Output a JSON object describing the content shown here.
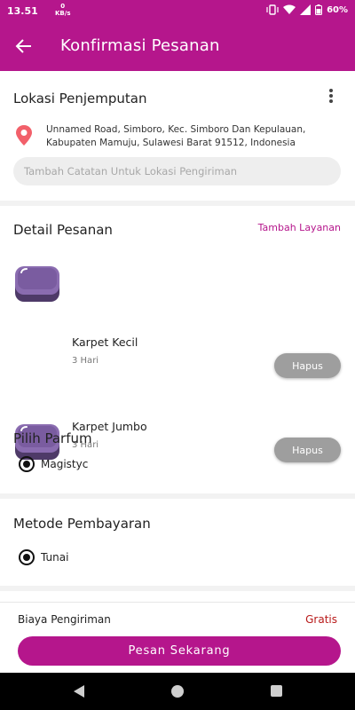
{
  "status_bar": {
    "time": "13.51",
    "netspeed_value": "0",
    "netspeed_unit": "KB/s",
    "battery": "60%"
  },
  "header": {
    "title": "Konfirmasi Pesanan"
  },
  "pickup": {
    "title": "Lokasi Penjemputan",
    "address": "Unnamed Road, Simboro, Kec. Simboro Dan Kepulauan, Kabupaten Mamuju, Sulawesi Barat 91512, Indonesia",
    "note_placeholder": "Tambah Catatan Untuk Lokasi Pengiriman",
    "note_value": ""
  },
  "order_detail": {
    "title": "Detail Pesanan",
    "add_service_label": "Tambah Layanan",
    "items": [
      {
        "name": "Karpet Kecil",
        "duration": "3 Hari",
        "remove_label": "Hapus"
      },
      {
        "name": "Karpet Jumbo",
        "duration": "3 Hari",
        "remove_label": "Hapus"
      }
    ]
  },
  "perfume": {
    "title": "Pilih Parfum",
    "selected": "Magistyc"
  },
  "payment": {
    "title": "Metode Pembayaran",
    "selected": "Tunai"
  },
  "summary": {
    "shipping_label": "Biaya Pengiriman",
    "shipping_value": "Gratis",
    "order_button": "Pesan Sekarang"
  },
  "colors": {
    "primary": "#b5168c",
    "price_text": "#b81a1a",
    "item_icon": "#6b4f8c"
  },
  "icons": {
    "back": "arrow-left-icon",
    "menu": "more-vert-icon",
    "location": "location-pin-icon",
    "item": "carpet-icon"
  }
}
